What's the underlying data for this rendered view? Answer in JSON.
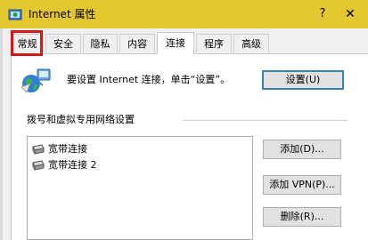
{
  "window": {
    "title": "Internet 属性",
    "help_glyph": "?",
    "close_glyph": "✕",
    "icon": "internet-options-icon"
  },
  "tabs": [
    {
      "label": "常规",
      "active": false
    },
    {
      "label": "安全",
      "active": false
    },
    {
      "label": "隐私",
      "active": false
    },
    {
      "label": "内容",
      "active": false
    },
    {
      "label": "连接",
      "active": true
    },
    {
      "label": "程序",
      "active": false
    },
    {
      "label": "高级",
      "active": false
    }
  ],
  "highlight": {
    "target": "常规",
    "color": "#d11919"
  },
  "setup": {
    "icon": "globe-network-icon",
    "text": "要设置 Internet 连接，单击“设置”。",
    "button": "设置(U)"
  },
  "dialup": {
    "section_label": "拨号和虚拟专用网络设置",
    "connections": [
      {
        "name": "宽带连接",
        "icon": "modem-icon"
      },
      {
        "name": "宽带连接 2",
        "icon": "modem-icon"
      }
    ],
    "buttons": {
      "add": "添加(D)...",
      "add_vpn": "添加 VPN(P)...",
      "remove": "删除(R)..."
    }
  },
  "colors": {
    "titlebar": "#e3c730",
    "dialog_bg": "#f0f0f0",
    "default_button_border": "#3c7fb1"
  }
}
